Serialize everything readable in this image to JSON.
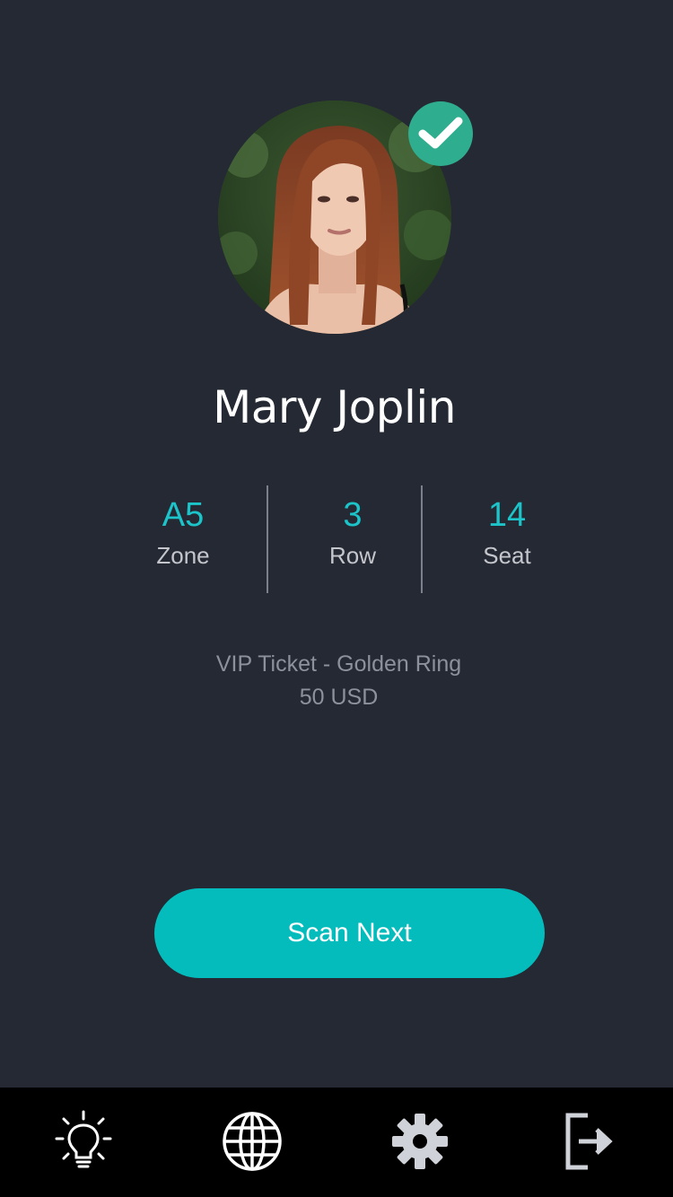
{
  "profile": {
    "name": "Mary Joplin",
    "verified": true,
    "avatar_icon": "person-photo"
  },
  "seat_info": {
    "zone": {
      "value": "A5",
      "label": "Zone"
    },
    "row": {
      "value": "3",
      "label": "Row"
    },
    "seat": {
      "value": "14",
      "label": "Seat"
    }
  },
  "ticket": {
    "type": "VIP Ticket - Golden Ring",
    "price": "50 USD"
  },
  "actions": {
    "scan_next_label": "Scan Next"
  },
  "tabbar": {
    "items": [
      "lightbulb-icon",
      "globe-icon",
      "gear-icon",
      "logout-icon"
    ]
  },
  "colors": {
    "background": "#252934",
    "accent": "#05bcbd",
    "verified": "#2fae8f",
    "tabbar": "#000000"
  }
}
